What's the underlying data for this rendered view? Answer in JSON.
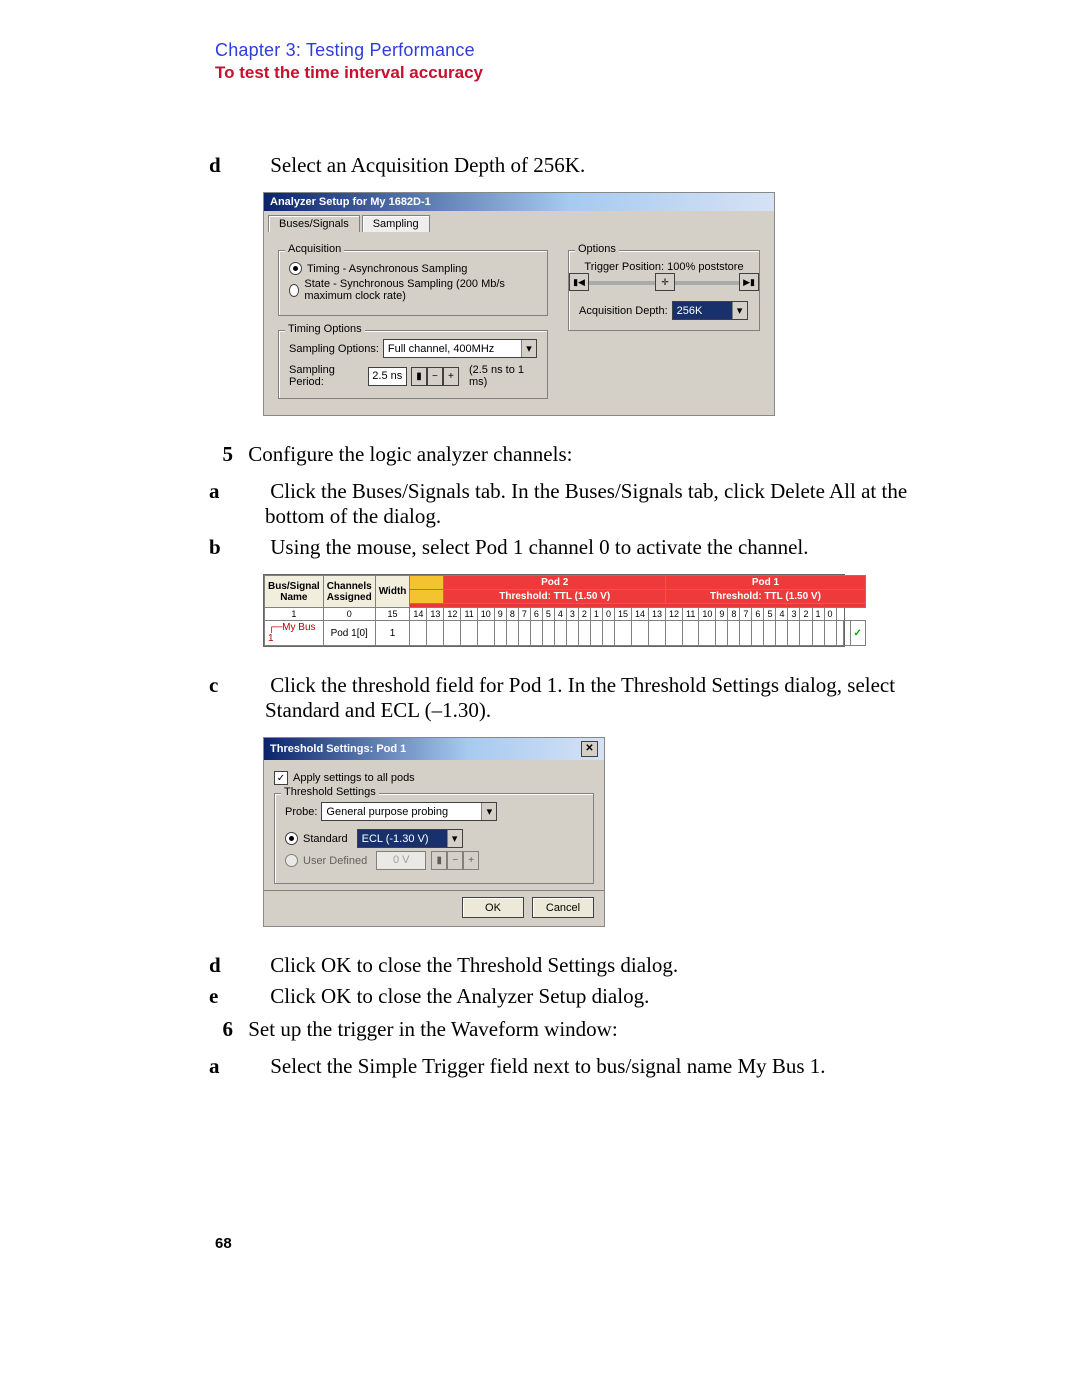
{
  "header": {
    "chapter": "Chapter 3: Testing Performance",
    "section": "To test the time interval accuracy"
  },
  "step_d_top": {
    "letter": "d",
    "text": "Select an Acquisition Depth of 256K."
  },
  "analyzer": {
    "title": "Analyzer Setup for My 1682D-1",
    "tabs": {
      "buses": "Buses/Signals",
      "sampling": "Sampling"
    },
    "acq": {
      "legend": "Acquisition",
      "opt1": "Timing - Asynchronous Sampling",
      "opt2": "State - Synchronous Sampling (200 Mb/s maximum clock rate)"
    },
    "timing": {
      "legend": "Timing Options",
      "sampling_opt_label": "Sampling Options:",
      "sampling_opt_value": "Full channel, 400MHz",
      "period_label": "Sampling Period:",
      "period_value": "2.5 ns",
      "period_range": "(2.5 ns to 1 ms)"
    },
    "options": {
      "legend": "Options",
      "trigger_label": "Trigger Position: 100% poststore",
      "depth_label": "Acquisition Depth:",
      "depth_value": "256K"
    }
  },
  "step5": {
    "num": "5",
    "text": "Configure the logic analyzer channels:"
  },
  "s5a": {
    "letter": "a",
    "text": "Click the Buses/Signals tab. In the Buses/Signals tab, click Delete All at the bottom of the dialog."
  },
  "s5b": {
    "letter": "b",
    "text": "Using the mouse, select Pod 1 channel 0 to activate the channel."
  },
  "grid": {
    "bus_signal_name": "Bus/Signal Name",
    "channels_assigned": "Channels Assigned",
    "width": "Width",
    "pod2": "Pod 2",
    "pod1": "Pod 1",
    "thresh": "Threshold: TTL (1.50 V)",
    "row_name": "My Bus 1",
    "row_channels": "Pod 1[0]",
    "row_width": "1",
    "chlabels": [
      "1",
      "0",
      "15",
      "14",
      "13",
      "12",
      "11",
      "10",
      "9",
      "8",
      "7",
      "6",
      "5",
      "4",
      "3",
      "2",
      "1",
      "0",
      "15",
      "14",
      "13",
      "12",
      "11",
      "10",
      "9",
      "8",
      "7",
      "6",
      "5",
      "4",
      "3",
      "2",
      "1",
      "0"
    ]
  },
  "s5c": {
    "letter": "c",
    "text": "Click the threshold field for Pod 1. In the Threshold Settings dialog, select Standard and ECL (–1.30)."
  },
  "threshold": {
    "title": "Threshold Settings: Pod 1",
    "apply_all": "Apply settings to all pods",
    "legend": "Threshold Settings",
    "probe_label": "Probe:",
    "probe_value": "General purpose probing",
    "standard": "Standard",
    "standard_value": "ECL (-1.30 V)",
    "user_defined": "User Defined",
    "user_value": "0 V",
    "ok": "OK",
    "cancel": "Cancel"
  },
  "s5d": {
    "letter": "d",
    "text": "Click OK to close the Threshold Settings dialog."
  },
  "s5e": {
    "letter": "e",
    "text": "Click OK to close the Analyzer Setup dialog."
  },
  "step6": {
    "num": "6",
    "text": "Set up the trigger in the Waveform window:"
  },
  "s6a": {
    "letter": "a",
    "text": "Select the Simple Trigger field next to bus/signal name My Bus 1."
  },
  "page_number": "68"
}
